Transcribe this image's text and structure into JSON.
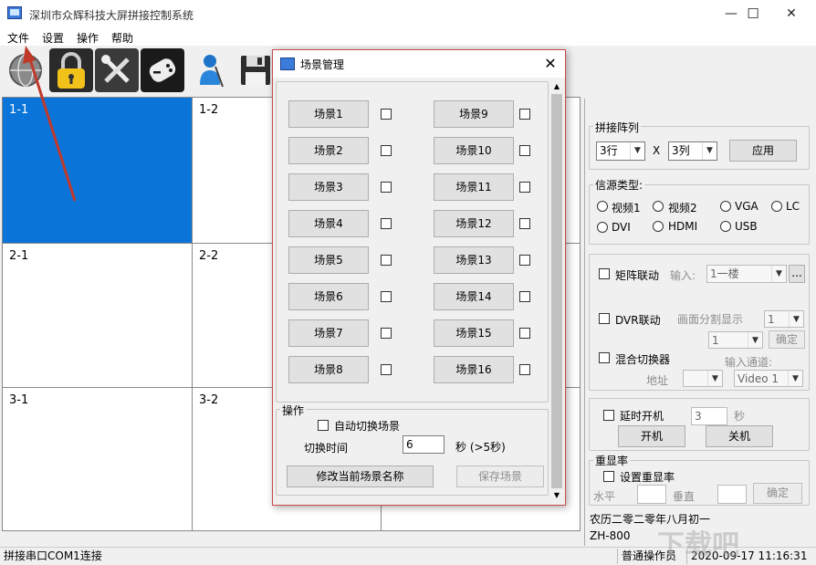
{
  "window": {
    "title": "深圳市众辉科技大屏拼接控制系统",
    "minimize": "—",
    "maximize": "☐",
    "close": "✕"
  },
  "menu": [
    "文件",
    "设置",
    "操作",
    "帮助"
  ],
  "toolbar": [
    {
      "icon": "globe-icon"
    },
    {
      "icon": "lock-icon"
    },
    {
      "icon": "tools-icon"
    },
    {
      "icon": "gamepad-icon"
    },
    {
      "icon": "user-pin-icon"
    },
    {
      "icon": "save-icon"
    }
  ],
  "grid": {
    "cells": [
      "1-1",
      "1-2",
      "",
      "2-1",
      "2-2",
      "",
      "3-1",
      "3-2",
      ""
    ],
    "selected": "1-1",
    "selected_color": "#0a74d8"
  },
  "dialog": {
    "title": "场景管理",
    "close": "✕",
    "scenes_left": [
      "场景1",
      "场景2",
      "场景3",
      "场景4",
      "场景5",
      "场景6",
      "场景7",
      "场景8"
    ],
    "scenes_right": [
      "场景9",
      "场景10",
      "场景11",
      "场景12",
      "场景13",
      "场景14",
      "场景15",
      "场景16"
    ],
    "ops_label": "操作",
    "auto_switch": "自动切换场景",
    "switch_time_label": "切换时间",
    "switch_time_value": "6",
    "switch_time_unit": "秒 (>5秒)",
    "rename_button": "修改当前场景名称",
    "save_button": "保存场景"
  },
  "panel": {
    "array_label": "拼接阵列",
    "rows_value": "3行",
    "x_symbol": "X",
    "cols_value": "3列",
    "apply_button": "应用",
    "source_label": "信源类型:",
    "sources": [
      "视频1",
      "视频2",
      "VGA",
      "LC",
      "DVI",
      "HDMI",
      "USB"
    ],
    "matrix_link": "矩阵联动",
    "input_label": "输入:",
    "input_value": "1一楼",
    "browse_button": "...",
    "dvr_link": "DVR联动",
    "split_label": "画面分割显示",
    "split_value": "1",
    "dvr_sub_value": "1",
    "confirm_button": "确定",
    "mixer": "混合切换器",
    "input_channel_label": "输入通道:",
    "address_label": "地址",
    "address_value": "",
    "channel_value": "Video 1",
    "delay_power": "延时开机",
    "delay_value": "3",
    "delay_unit": "秒",
    "power_on": "开机",
    "power_off": "关机",
    "refresh_group": "重显率",
    "set_refresh": "设置重显率",
    "horizontal_label": "水平",
    "vertical_label": "垂直",
    "refresh_confirm": "确定",
    "lunar_date": "农历二零二零年八月初一",
    "model": "ZH-800"
  },
  "status": {
    "connection": "拼接串口COM1连接",
    "user": "普通操作员",
    "datetime": "2020-09-17 11:16:31"
  },
  "watermark": "下载吧"
}
